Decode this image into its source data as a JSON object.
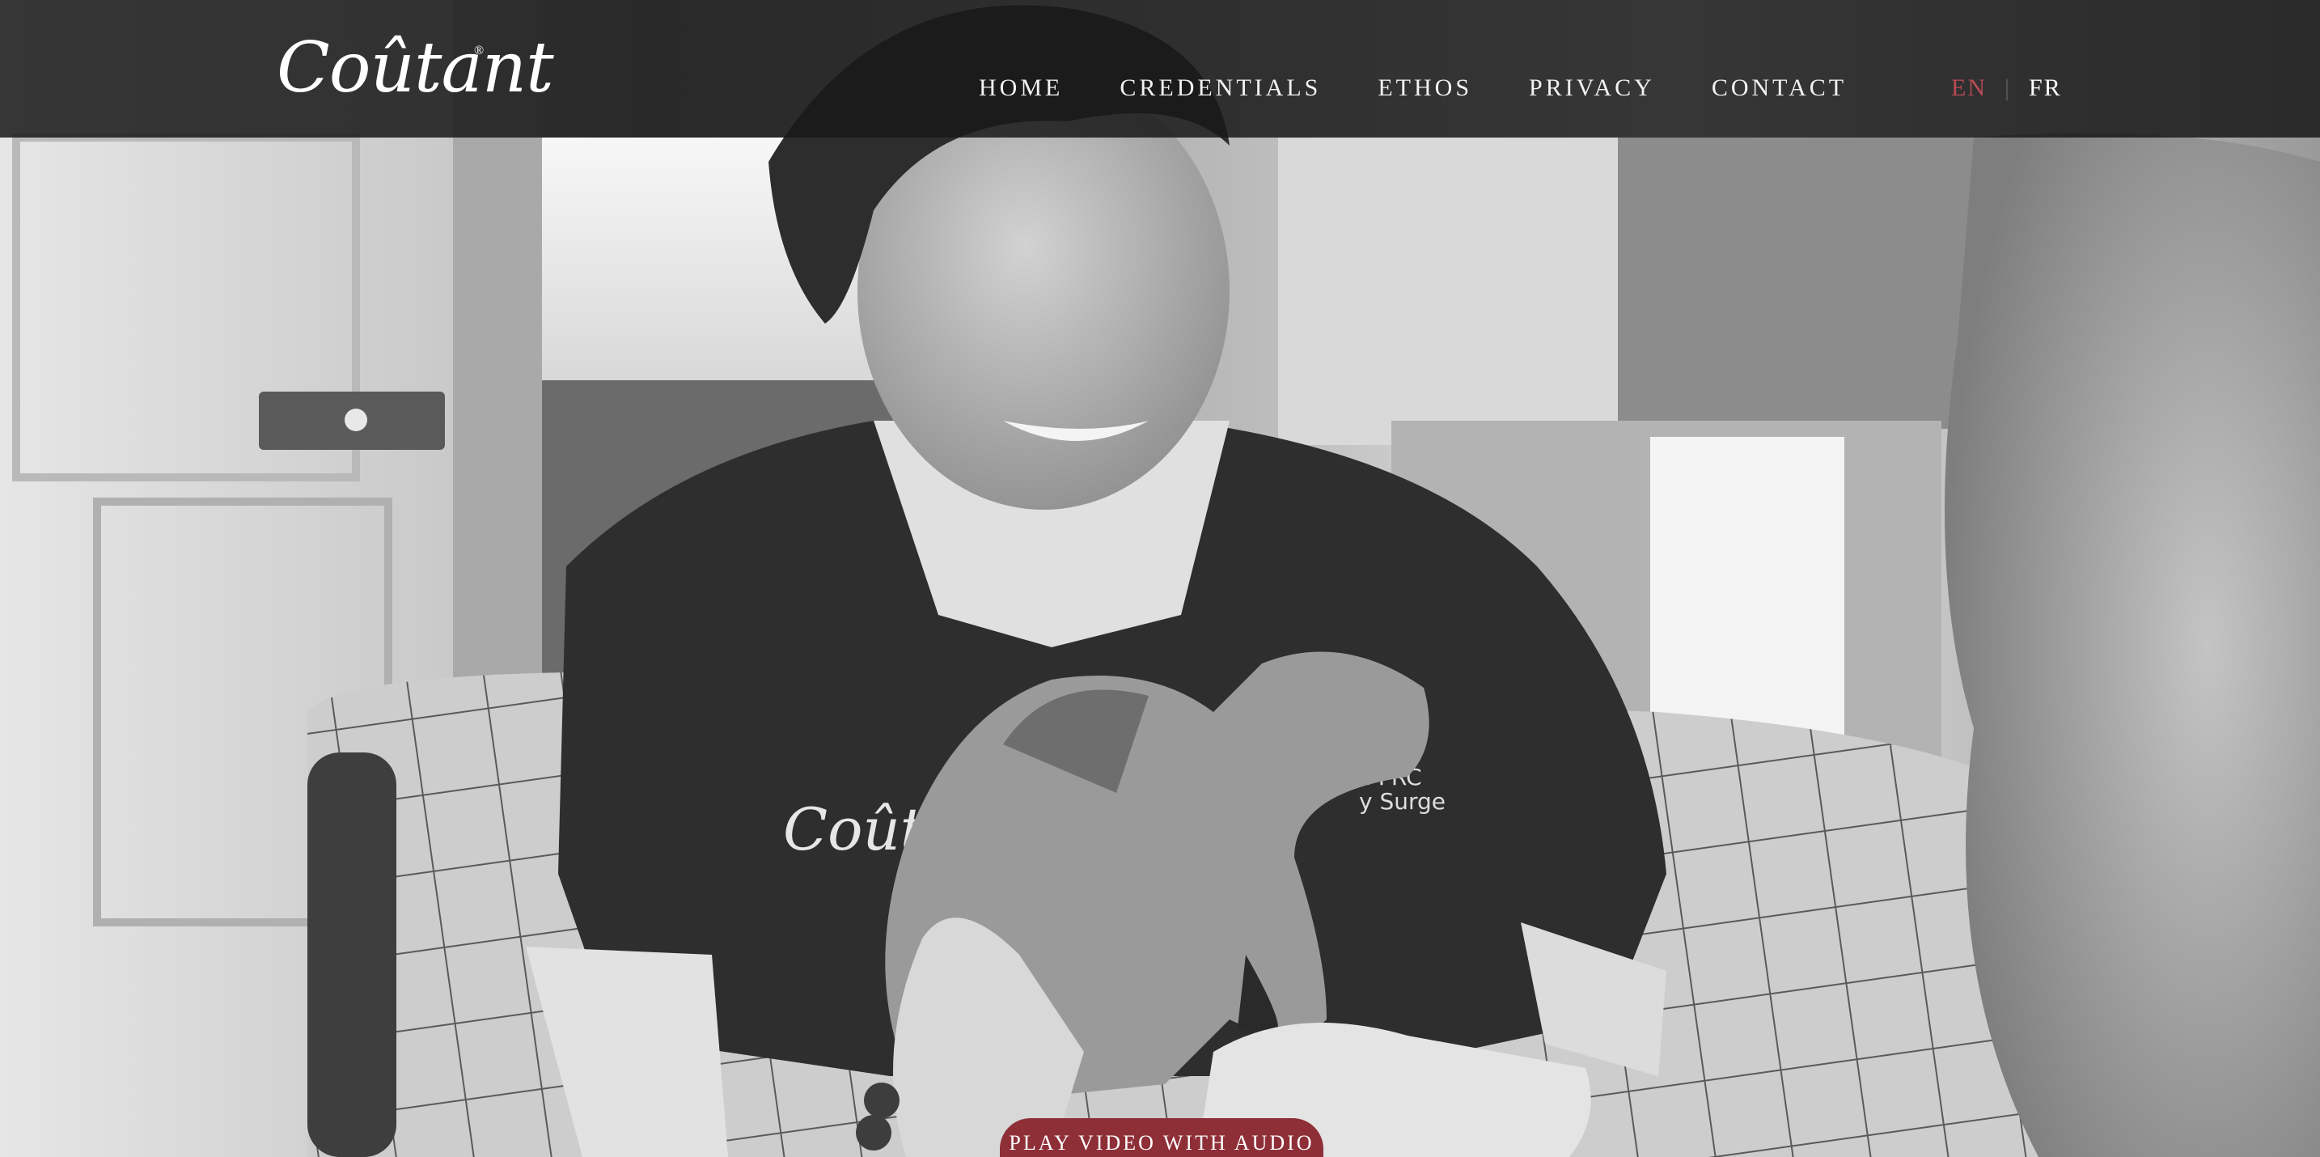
{
  "header": {
    "logo_text": "Coûtant",
    "logo_mark": "®"
  },
  "nav": {
    "items": [
      {
        "label": "HOME"
      },
      {
        "label": "CREDENTIALS"
      },
      {
        "label": "ETHOS"
      },
      {
        "label": "PRIVACY"
      },
      {
        "label": "CONTACT"
      }
    ]
  },
  "language": {
    "active": "EN",
    "separator": "|",
    "other": "FR"
  },
  "hero": {
    "shirt_logo_text": "Coûtant",
    "shirt_text_line1": "on FRC",
    "shirt_text_line2": "y Surge"
  },
  "cta": {
    "play_video_label": "PLAY VIDEO WITH AUDIO"
  },
  "colors": {
    "accent": "#8e2f38",
    "active_language": "#b84a55",
    "header_bg": "#191919"
  }
}
